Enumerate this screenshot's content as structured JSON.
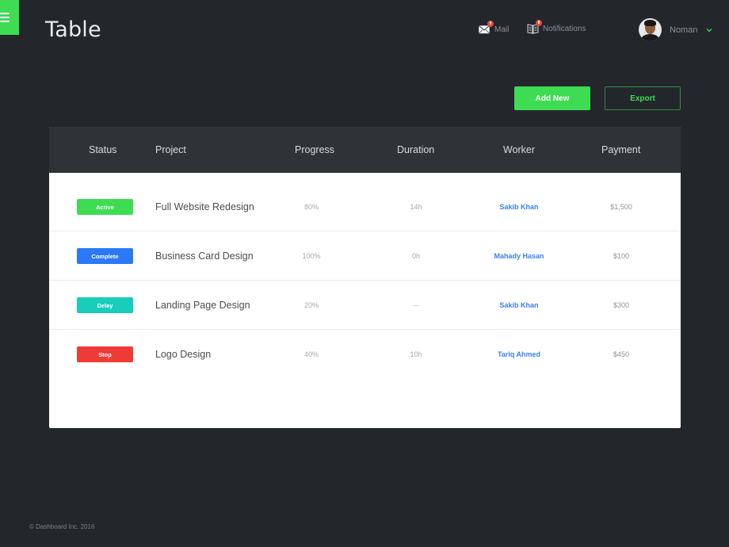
{
  "header": {
    "title": "Table",
    "menu_icon": "hamburger-menu-icon",
    "nav": [
      {
        "label": "Mail",
        "icon": "mail-icon",
        "badge": "9"
      },
      {
        "label": "Notifications",
        "icon": "notifications-book-icon",
        "badge": "8"
      }
    ],
    "user": {
      "name": "Noman",
      "avatar": "user-avatar",
      "dropdown_icon": "chevron-down-icon"
    }
  },
  "toolbar": {
    "add_label": "Add New",
    "export_label": "Export"
  },
  "colors": {
    "accent": "#3edc53",
    "background": "#23262b",
    "table_header": "#2f3338",
    "link": "#3a82ef",
    "status": {
      "Active": "#3edc53",
      "Complete": "#2b79f7",
      "Delay": "#18cdb9",
      "Stop": "#ef3b37"
    }
  },
  "table": {
    "columns": [
      "Status",
      "Project",
      "Progress",
      "Duration",
      "Worker",
      "Payment"
    ],
    "rows": [
      {
        "status": "Active",
        "project": "Full Website Redesign",
        "progress": "80%",
        "duration": "14h",
        "worker": "Sakib Khan",
        "payment": "$1,500"
      },
      {
        "status": "Complete",
        "project": "Business Card Design",
        "progress": "100%",
        "duration": "0h",
        "worker": "Mahady Hasan",
        "payment": "$100"
      },
      {
        "status": "Delay",
        "project": "Landing Page Design",
        "progress": "20%",
        "duration": "--",
        "worker": "Sakib Khan",
        "payment": "$300"
      },
      {
        "status": "Stop",
        "project": "Logo Design",
        "progress": "40%",
        "duration": "10h",
        "worker": "Tariq Ahmed",
        "payment": "$450"
      }
    ]
  },
  "footer": {
    "copyright": "© Dashboard Inc. 2016"
  }
}
